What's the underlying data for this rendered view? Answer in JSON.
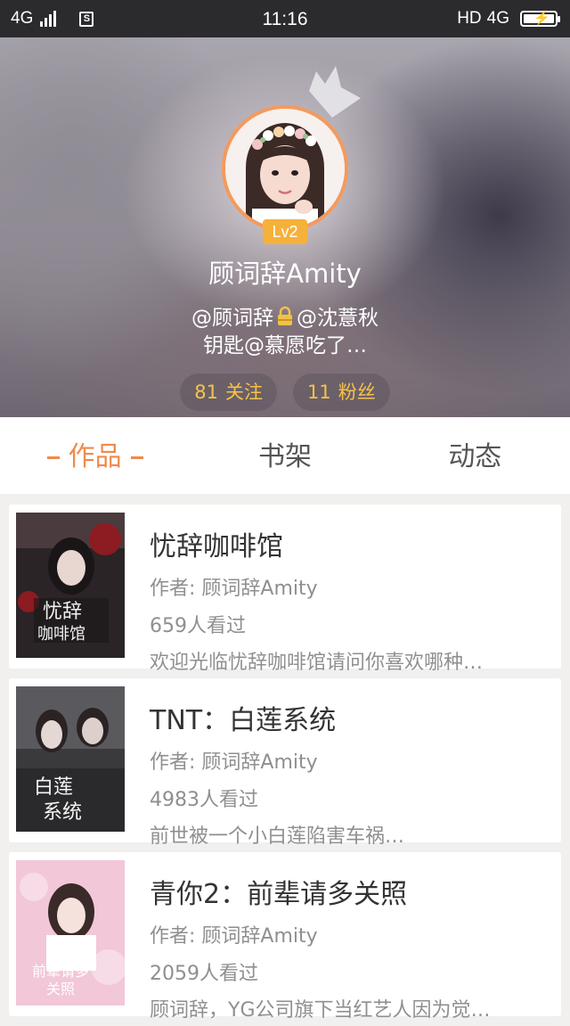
{
  "status_bar": {
    "network": "4G",
    "time": "11:16",
    "hd": "HD",
    "network_right": "4G"
  },
  "profile": {
    "level": "Lv2",
    "username": "顾词辞Amity",
    "bio_part1": "@顾词辞",
    "bio_part2": "@沈薏秋",
    "bio_line2": "钥匙@慕愿吃了…",
    "following_count": "81",
    "following_label": "关注",
    "followers_count": "11",
    "followers_label": "粉丝"
  },
  "tabs": [
    {
      "label": "作品",
      "active": true
    },
    {
      "label": "书架",
      "active": false
    },
    {
      "label": "动态",
      "active": false
    }
  ],
  "books": [
    {
      "title": "忧辞咖啡馆",
      "author": "作者: 顾词辞Amity",
      "views": "659人看过",
      "description": "欢迎光临忧辞咖啡馆请问你喜欢哪种…"
    },
    {
      "title": "TNT：白莲系统",
      "author": "作者: 顾词辞Amity",
      "views": "4983人看过",
      "description": "前世被一个小白莲陷害车祸…"
    },
    {
      "title": "青你2：前辈请多关照",
      "author": "作者: 顾词辞Amity",
      "views": "2059人看过",
      "description": "顾词辞，YG公司旗下当红艺人因为觉…"
    }
  ],
  "colors": {
    "accent": "#f08a4b",
    "gold": "#f6c348",
    "level_badge": "#f6b13a",
    "avatar_ring": "#f49a5c"
  }
}
